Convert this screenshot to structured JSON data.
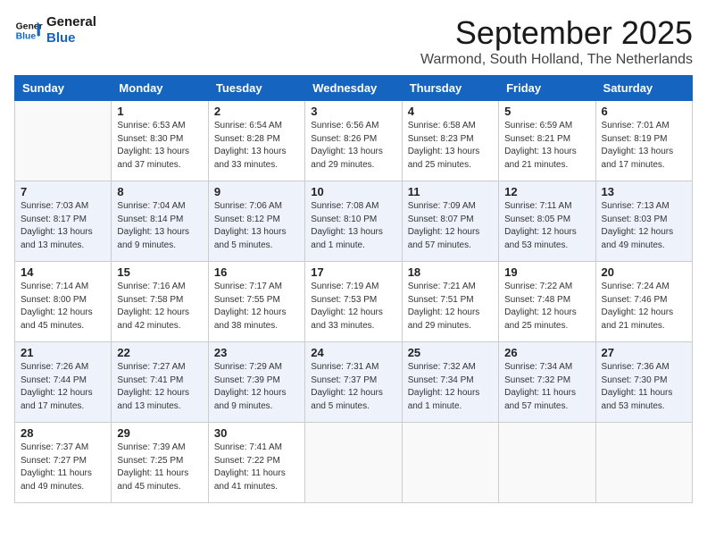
{
  "header": {
    "logo_line1": "General",
    "logo_line2": "Blue",
    "month": "September 2025",
    "location": "Warmond, South Holland, The Netherlands"
  },
  "weekdays": [
    "Sunday",
    "Monday",
    "Tuesday",
    "Wednesday",
    "Thursday",
    "Friday",
    "Saturday"
  ],
  "weeks": [
    [
      {
        "day": "",
        "info": ""
      },
      {
        "day": "1",
        "info": "Sunrise: 6:53 AM\nSunset: 8:30 PM\nDaylight: 13 hours\nand 37 minutes."
      },
      {
        "day": "2",
        "info": "Sunrise: 6:54 AM\nSunset: 8:28 PM\nDaylight: 13 hours\nand 33 minutes."
      },
      {
        "day": "3",
        "info": "Sunrise: 6:56 AM\nSunset: 8:26 PM\nDaylight: 13 hours\nand 29 minutes."
      },
      {
        "day": "4",
        "info": "Sunrise: 6:58 AM\nSunset: 8:23 PM\nDaylight: 13 hours\nand 25 minutes."
      },
      {
        "day": "5",
        "info": "Sunrise: 6:59 AM\nSunset: 8:21 PM\nDaylight: 13 hours\nand 21 minutes."
      },
      {
        "day": "6",
        "info": "Sunrise: 7:01 AM\nSunset: 8:19 PM\nDaylight: 13 hours\nand 17 minutes."
      }
    ],
    [
      {
        "day": "7",
        "info": "Sunrise: 7:03 AM\nSunset: 8:17 PM\nDaylight: 13 hours\nand 13 minutes."
      },
      {
        "day": "8",
        "info": "Sunrise: 7:04 AM\nSunset: 8:14 PM\nDaylight: 13 hours\nand 9 minutes."
      },
      {
        "day": "9",
        "info": "Sunrise: 7:06 AM\nSunset: 8:12 PM\nDaylight: 13 hours\nand 5 minutes."
      },
      {
        "day": "10",
        "info": "Sunrise: 7:08 AM\nSunset: 8:10 PM\nDaylight: 13 hours\nand 1 minute."
      },
      {
        "day": "11",
        "info": "Sunrise: 7:09 AM\nSunset: 8:07 PM\nDaylight: 12 hours\nand 57 minutes."
      },
      {
        "day": "12",
        "info": "Sunrise: 7:11 AM\nSunset: 8:05 PM\nDaylight: 12 hours\nand 53 minutes."
      },
      {
        "day": "13",
        "info": "Sunrise: 7:13 AM\nSunset: 8:03 PM\nDaylight: 12 hours\nand 49 minutes."
      }
    ],
    [
      {
        "day": "14",
        "info": "Sunrise: 7:14 AM\nSunset: 8:00 PM\nDaylight: 12 hours\nand 45 minutes."
      },
      {
        "day": "15",
        "info": "Sunrise: 7:16 AM\nSunset: 7:58 PM\nDaylight: 12 hours\nand 42 minutes."
      },
      {
        "day": "16",
        "info": "Sunrise: 7:17 AM\nSunset: 7:55 PM\nDaylight: 12 hours\nand 38 minutes."
      },
      {
        "day": "17",
        "info": "Sunrise: 7:19 AM\nSunset: 7:53 PM\nDaylight: 12 hours\nand 33 minutes."
      },
      {
        "day": "18",
        "info": "Sunrise: 7:21 AM\nSunset: 7:51 PM\nDaylight: 12 hours\nand 29 minutes."
      },
      {
        "day": "19",
        "info": "Sunrise: 7:22 AM\nSunset: 7:48 PM\nDaylight: 12 hours\nand 25 minutes."
      },
      {
        "day": "20",
        "info": "Sunrise: 7:24 AM\nSunset: 7:46 PM\nDaylight: 12 hours\nand 21 minutes."
      }
    ],
    [
      {
        "day": "21",
        "info": "Sunrise: 7:26 AM\nSunset: 7:44 PM\nDaylight: 12 hours\nand 17 minutes."
      },
      {
        "day": "22",
        "info": "Sunrise: 7:27 AM\nSunset: 7:41 PM\nDaylight: 12 hours\nand 13 minutes."
      },
      {
        "day": "23",
        "info": "Sunrise: 7:29 AM\nSunset: 7:39 PM\nDaylight: 12 hours\nand 9 minutes."
      },
      {
        "day": "24",
        "info": "Sunrise: 7:31 AM\nSunset: 7:37 PM\nDaylight: 12 hours\nand 5 minutes."
      },
      {
        "day": "25",
        "info": "Sunrise: 7:32 AM\nSunset: 7:34 PM\nDaylight: 12 hours\nand 1 minute."
      },
      {
        "day": "26",
        "info": "Sunrise: 7:34 AM\nSunset: 7:32 PM\nDaylight: 11 hours\nand 57 minutes."
      },
      {
        "day": "27",
        "info": "Sunrise: 7:36 AM\nSunset: 7:30 PM\nDaylight: 11 hours\nand 53 minutes."
      }
    ],
    [
      {
        "day": "28",
        "info": "Sunrise: 7:37 AM\nSunset: 7:27 PM\nDaylight: 11 hours\nand 49 minutes."
      },
      {
        "day": "29",
        "info": "Sunrise: 7:39 AM\nSunset: 7:25 PM\nDaylight: 11 hours\nand 45 minutes."
      },
      {
        "day": "30",
        "info": "Sunrise: 7:41 AM\nSunset: 7:22 PM\nDaylight: 11 hours\nand 41 minutes."
      },
      {
        "day": "",
        "info": ""
      },
      {
        "day": "",
        "info": ""
      },
      {
        "day": "",
        "info": ""
      },
      {
        "day": "",
        "info": ""
      }
    ]
  ]
}
